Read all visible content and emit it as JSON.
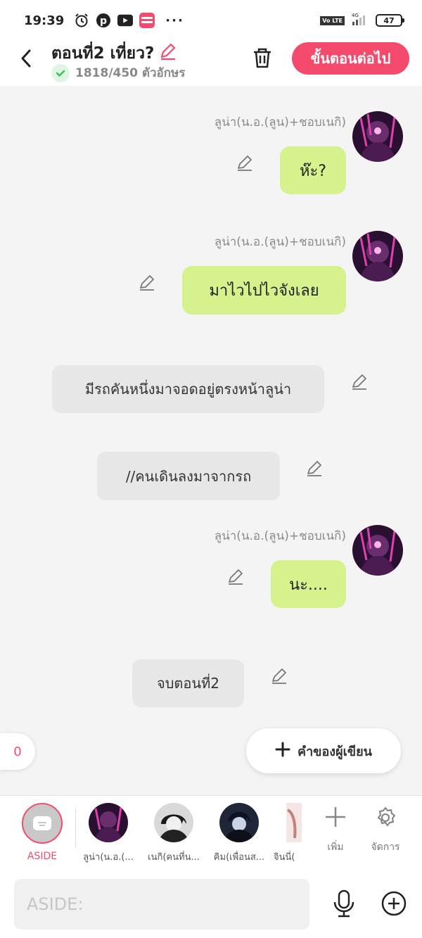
{
  "status_bar": {
    "time": "19:39",
    "icons": [
      "alarm-icon",
      "pinterest-icon",
      "youtube-icon",
      "mangatoon-icon"
    ],
    "more": "···",
    "network": "4G",
    "volte": "Vo LTE",
    "battery": "47"
  },
  "header": {
    "title": "ตอนที่2 เที่ยว?",
    "char_count": "1818/450 ตัวอักษร",
    "next_label": "ขั้นตอนต่อไป"
  },
  "messages": [
    {
      "type": "character",
      "speaker": "ลูน่า(น.อ.(ลูน)+ชอบเนกิ)",
      "text": "ห๊ะ?"
    },
    {
      "type": "character",
      "speaker": "ลูน่า(น.อ.(ลูน)+ชอบเนกิ)",
      "text": "มาไวไปไวจังเลย"
    },
    {
      "type": "aside",
      "text": "มีรถคันหนึ่งมาจอดอยู่ตรงหน้าลูน่า"
    },
    {
      "type": "aside",
      "text": "//คนเดินลงมาจากรถ"
    },
    {
      "type": "character",
      "speaker": "ลูน่า(น.อ.(ลูน)+ชอบเนกิ)",
      "text": "นะ...."
    },
    {
      "type": "aside",
      "text": "จบตอนที่2"
    }
  ],
  "floating": {
    "count": "0",
    "author_note_label": "คำของผู้เขียน"
  },
  "characters": {
    "aside_label": "ASIDE",
    "items": [
      {
        "name": "ลูน่า(น.อ.(..."
      },
      {
        "name": "เนกิ(คนที่น..."
      },
      {
        "name": "คิม(เพื่อนส..."
      },
      {
        "name": "จินนี่("
      }
    ],
    "add_label": "เพิ่ม",
    "manage_label": "จัดการ"
  },
  "input": {
    "placeholder": "ASIDE:"
  },
  "colors": {
    "accent": "#f44a6c",
    "bubble_green": "#d5f28c",
    "bubble_gray": "#e7e7e7"
  }
}
